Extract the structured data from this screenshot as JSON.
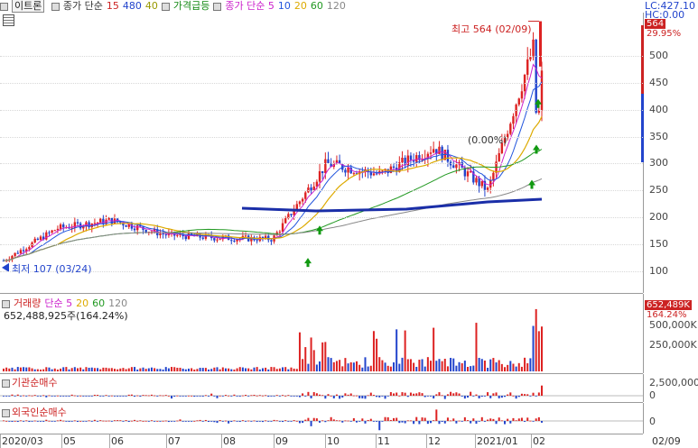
{
  "header": {
    "stock_name": "이트론",
    "legend": [
      {
        "label": "종가 단순",
        "color": "#333333"
      },
      {
        "label": "15",
        "color": "#cc2222"
      },
      {
        "label": "480",
        "color": "#2244cc"
      },
      {
        "label": "40",
        "color": "#999900"
      },
      {
        "label": "가격급등",
        "color": "#118811"
      },
      {
        "label": "종가 단순 5",
        "color": "#cc22cc"
      },
      {
        "label": "10",
        "color": "#2255dd"
      },
      {
        "label": "20",
        "color": "#ddaa00"
      },
      {
        "label": "60",
        "color": "#229922"
      },
      {
        "label": "120",
        "color": "#888888"
      }
    ],
    "lc_label": "LC:427.10",
    "hc_label": "HC:0.00",
    "current_price_tag": "564",
    "change_pct_tag": "29.95%"
  },
  "price_chart": {
    "type": "candlestick",
    "ylim": [
      60,
      580
    ],
    "y_ticks": [
      "500",
      "450",
      "400",
      "350",
      "300",
      "250",
      "200",
      "150",
      "100"
    ],
    "high_annotation": "최고 564 (02/09)",
    "low_annotation": "최저 107 (03/24)",
    "mid_annotation": "(0.00%)",
    "x_labels": [
      "2020/03",
      "05",
      "06",
      "07",
      "08",
      "09",
      "10",
      "11",
      "12",
      "2021/01",
      "02"
    ],
    "trendline_label": ""
  },
  "volume_panel": {
    "legend": [
      {
        "label": "거래량",
        "color": "#cc2222"
      },
      {
        "label": "단순 5",
        "color": "#cc22cc"
      },
      {
        "label": "20",
        "color": "#ddaa00"
      },
      {
        "label": "60",
        "color": "#229922"
      },
      {
        "label": "120",
        "color": "#888888"
      }
    ],
    "summary": "652,488,925주(164.24%)",
    "y_ticks": [
      "500,000K",
      "250,000K"
    ],
    "tag_value": "652,489K",
    "tag_pct": "164.24%"
  },
  "inst_panel": {
    "title": "기관순매수",
    "y_ticks": [
      "2,500,000",
      "0"
    ]
  },
  "foreign_panel": {
    "title": "외국인순매수",
    "y_ticks": [
      "0"
    ]
  },
  "x_axis": {
    "labels": [
      "2020/03",
      "05",
      "06",
      "07",
      "08",
      "09",
      "10",
      "11",
      "12",
      "2021/01",
      "02"
    ],
    "right_label": "02/09"
  },
  "chart_data": {
    "type": "line",
    "title": "",
    "x": [
      "2020/03",
      "05",
      "06",
      "07",
      "08",
      "09",
      "10",
      "11",
      "12",
      "2021/01",
      "02"
    ],
    "series": [
      {
        "values": [
          120,
          180,
          195,
          168,
          162,
          160,
          300,
          280,
          330,
          250,
          564
        ]
      }
    ],
    "ylim": [
      60,
      580
    ],
    "xlabel": "",
    "ylabel": ""
  }
}
